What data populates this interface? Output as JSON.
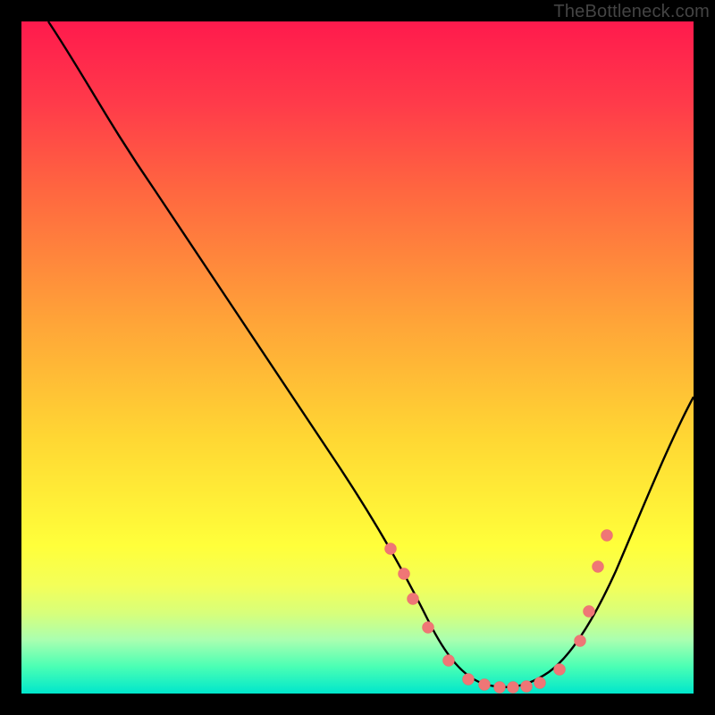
{
  "watermark": "TheBottleneck.com",
  "colors": {
    "frame": "#000000",
    "curve": "#000000",
    "dot_fill": "#ef7676",
    "dot_stroke": "#bb4a4a"
  },
  "chart_data": {
    "type": "line",
    "title": "",
    "xlabel": "",
    "ylabel": "",
    "xlim": [
      0,
      100
    ],
    "ylim": [
      0,
      100
    ],
    "note": "No axis ticks or numeric labels are visible; x/y are estimated percentages of plot width/height from the curve geometry. y=0 at bottom.",
    "series": [
      {
        "name": "bottleneck-curve",
        "x": [
          4,
          10,
          20,
          30,
          40,
          50,
          55,
          58,
          62,
          66,
          70,
          74,
          78,
          82,
          86,
          92,
          100
        ],
        "y": [
          100,
          93,
          79,
          64,
          48,
          30,
          19,
          12,
          6,
          2.5,
          1,
          1,
          2,
          5,
          12,
          24,
          42
        ]
      }
    ],
    "scatter_dots": {
      "name": "highlighted-points",
      "x": [
        55,
        57,
        58.5,
        61,
        64,
        67,
        69,
        71,
        73,
        75,
        77,
        80,
        83,
        84,
        85.5,
        87
      ],
      "y": [
        22,
        18,
        14,
        10,
        5,
        2.5,
        1.5,
        1,
        1,
        1,
        1.3,
        3,
        8,
        12,
        19,
        24
      ]
    }
  }
}
